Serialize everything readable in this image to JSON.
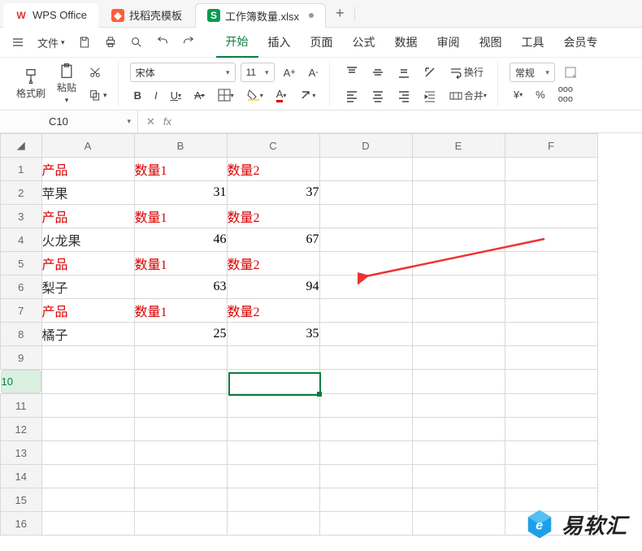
{
  "tabs": {
    "office": "WPS Office",
    "template": "找稻壳模板",
    "file": "工作簿数量.xlsx",
    "add": "+"
  },
  "menu": {
    "file": "文件",
    "items": [
      "开始",
      "插入",
      "页面",
      "公式",
      "数据",
      "审阅",
      "视图",
      "工具",
      "会员专"
    ]
  },
  "ribbon": {
    "format_painter": "格式刷",
    "paste": "粘贴",
    "font_name": "宋体",
    "font_size": "11",
    "bold": "B",
    "italic": "I",
    "underline": "U",
    "wrap": "换行",
    "merge": "合并",
    "format_sel": "常规",
    "currency": "¥",
    "percent": "%"
  },
  "namebox": {
    "value": "C10"
  },
  "fx": {
    "label": "fx"
  },
  "columns": [
    "A",
    "B",
    "C",
    "D",
    "E",
    "F"
  ],
  "rows": [
    "1",
    "2",
    "3",
    "4",
    "5",
    "6",
    "7",
    "8",
    "9",
    "10",
    "11",
    "12",
    "13",
    "14",
    "15",
    "16"
  ],
  "cells": {
    "r1": {
      "a": "产品",
      "b": "数量1",
      "c": "数量2"
    },
    "r2": {
      "a": "苹果",
      "b": "31",
      "c": "37"
    },
    "r3": {
      "a": "产品",
      "b": "数量1",
      "c": "数量2"
    },
    "r4": {
      "a": "火龙果",
      "b": "46",
      "c": "67"
    },
    "r5": {
      "a": "产品",
      "b": "数量1",
      "c": "数量2"
    },
    "r6": {
      "a": "梨子",
      "b": "63",
      "c": "94"
    },
    "r7": {
      "a": "产品",
      "b": "数量1",
      "c": "数量2"
    },
    "r8": {
      "a": "橘子",
      "b": "25",
      "c": "35"
    }
  },
  "watermark": "易软汇"
}
